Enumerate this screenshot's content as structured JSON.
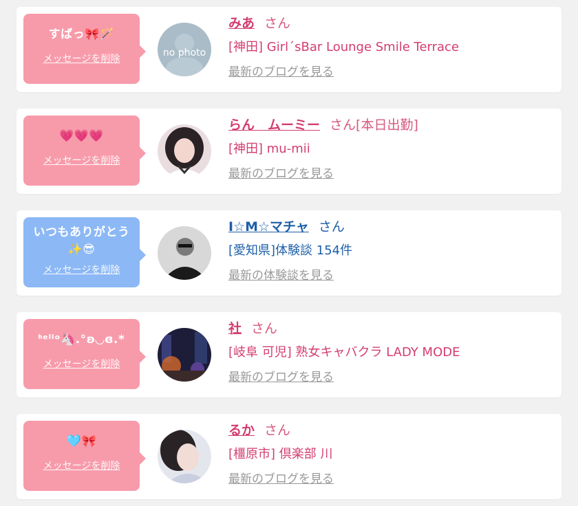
{
  "cards": [
    {
      "message": "すばっ🎀🪄",
      "delete_label": "メッセージを削除",
      "name": "みあ",
      "san": "さん",
      "status": "",
      "shop": "[神田] Girl´sBar Lounge Smile Terrace",
      "link": "最新のブログを見る",
      "avatar_text": "no photo",
      "theme": "pink"
    },
    {
      "message": "💗💗💗",
      "delete_label": "メッセージを削除",
      "name": "らん　ムーミー",
      "san": "さん",
      "status": "[本日出勤]",
      "shop": "[神田] mu-mii",
      "link": "最新のブログを見る",
      "theme": "pink"
    },
    {
      "message": "いつもありがとう\n✨😎",
      "delete_label": "メッセージを削除",
      "name": "I☆M☆マチャ",
      "san": "さん",
      "status": "",
      "shop": "[愛知県]体験談 154件",
      "link": "最新の体験談を見る",
      "theme": "blue"
    },
    {
      "message": "ᑋᵉᑊᑊᵒ🦄.°ʚ◡ɞ.*",
      "delete_label": "メッセージを削除",
      "name": "社",
      "san": "さん",
      "status": "",
      "shop": "[岐阜 可児] 熟女キャバクラ LADY MODE",
      "link": "最新のブログを見る",
      "theme": "pink"
    },
    {
      "message": "🩵🎀",
      "delete_label": "メッセージを削除",
      "name": "るか",
      "san": "さん",
      "status": "",
      "shop": "[橿原市] 倶楽部 川",
      "link": "最新のブログを見る",
      "theme": "pink"
    }
  ],
  "colors": {
    "bubble_pink": "#f79bab",
    "bubble_blue": "#8cb8f5",
    "name_pink": "#d33d6e",
    "name_blue": "#1e5fa8",
    "link_gray": "#999999"
  }
}
